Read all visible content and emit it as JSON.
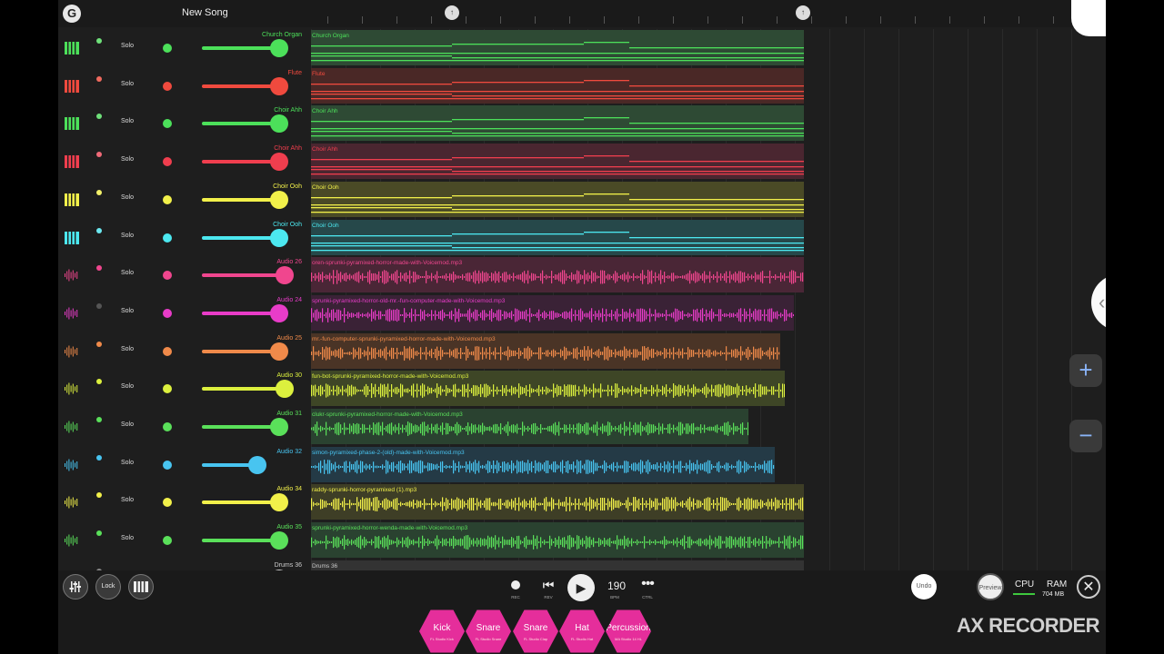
{
  "header": {
    "logo_glyph": "G",
    "song_title": "New Song",
    "marker_a": "↑",
    "marker_b": "↑"
  },
  "solo_label": "Solo",
  "tracks": [
    {
      "name": "Church Organ",
      "clip": "Church Organ",
      "type": "keys",
      "color": "#4ce05a",
      "bg": "#2e4a34",
      "volume": 0.85,
      "mute_color": "#6fe07a",
      "clip_end": 0.62
    },
    {
      "name": "Flute",
      "clip": "Flute",
      "type": "keys",
      "color": "#f04a3e",
      "bg": "#4a2826",
      "volume": 0.85,
      "mute_color": "#f06a5e",
      "clip_end": 0.62
    },
    {
      "name": "Choir Ahh",
      "clip": "Choir Ahh",
      "type": "keys",
      "color": "#4ce05a",
      "bg": "#2e4a34",
      "volume": 0.85,
      "mute_color": "#6fe07a",
      "clip_end": 0.62
    },
    {
      "name": "Choir Ahh",
      "clip": "Choir Ahh",
      "type": "keys",
      "color": "#f03e4e",
      "bg": "#4a2630",
      "volume": 0.85,
      "mute_color": "#f06a78",
      "clip_end": 0.62
    },
    {
      "name": "Choir Ooh",
      "clip": "Choir Ooh",
      "type": "keys",
      "color": "#f2f04a",
      "bg": "#4a4a26",
      "volume": 0.85,
      "mute_color": "#f2f06a",
      "clip_end": 0.62
    },
    {
      "name": "Choir Ooh",
      "clip": "Choir Ooh",
      "type": "keys",
      "color": "#4ce8f0",
      "bg": "#26484a",
      "volume": 0.85,
      "mute_color": "#6ce8f0",
      "clip_end": 0.62
    },
    {
      "name": "Audio 26",
      "clip": "oren-sprunki-pyramixed-horror-made-with-Voicemod.mp3",
      "type": "audio",
      "color": "#f0468e",
      "bg": "#4a2636",
      "volume": 0.92,
      "mute_color": "#f0468e",
      "clip_end": 0.62
    },
    {
      "name": "Audio 24",
      "clip": "sprunki-pyramixed-horror-old-mr.-fun-computer-made-with-Voicemod.mp3",
      "type": "audio",
      "color": "#e83cc8",
      "bg": "#3a2236",
      "volume": 0.85,
      "mute_color": "#555555",
      "clip_end": 0.608
    },
    {
      "name": "Audio 25",
      "clip": "mr.-fun-computer-sprunki-pyramixed-horror-made-with-Voicemod.mp3",
      "type": "audio",
      "color": "#f08a4a",
      "bg": "#4a3426",
      "volume": 0.85,
      "mute_color": "#f08a4a",
      "clip_end": 0.59
    },
    {
      "name": "Audio 30",
      "clip": "fun-bot-sprunki-pyramixed-horror-made-with-Voicemod.mp3",
      "type": "audio",
      "color": "#dcf03e",
      "bg": "#3e4626",
      "volume": 0.92,
      "mute_color": "#dcf03e",
      "clip_end": 0.596
    },
    {
      "name": "Audio 31",
      "clip": "clukr-sprunki-pyramixed-horror-made-with-Voicemod.mp3",
      "type": "audio",
      "color": "#5ae05a",
      "bg": "#2a4230",
      "volume": 0.85,
      "mute_color": "#5ae05a",
      "clip_end": 0.55
    },
    {
      "name": "Audio 32",
      "clip": "simon-pyramixed-phase-2-(old)-made-with-Voicemod.mp3",
      "type": "audio",
      "color": "#48c4f0",
      "bg": "#243a46",
      "volume": 0.6,
      "mute_color": "#48c4f0",
      "clip_end": 0.584
    },
    {
      "name": "Audio 34",
      "clip": "raddy-sprunki-horror-pyramixed (1).mp3",
      "type": "audio",
      "color": "#f2f04a",
      "bg": "#3e3e26",
      "volume": 0.85,
      "mute_color": "#f2f04a",
      "clip_end": 0.62
    },
    {
      "name": "Audio 35",
      "clip": "sprunki-pyramixed-horror-wenda-made-with-Voicemod.mp3",
      "type": "audio",
      "color": "#5ae05a",
      "bg": "#2a4230",
      "volume": 0.85,
      "mute_color": "#5ae05a",
      "clip_end": 0.62
    },
    {
      "name": "Drums 36",
      "clip": "Drums 36",
      "type": "drums",
      "color": "#cccccc",
      "bg": "#333333",
      "volume": 0.85,
      "mute_color": "#888888",
      "clip_end": 0.62
    }
  ],
  "side": {
    "chevron": "‹",
    "zoom_in": "+",
    "zoom_out": "−"
  },
  "bottom": {
    "mixer_icon": "mixer-icon",
    "lock_label": "Lock",
    "keyboard_icon": "piano-icon",
    "rec_label": "REC",
    "rev_label": "REV",
    "bpm_value": "190",
    "bpm_label": "BPM",
    "ctrl_label": "CTRL",
    "undo_label": "Undo",
    "preview_label": "Preview",
    "cpu_label": "CPU",
    "ram_label": "RAM",
    "ram_value": "704 MB",
    "close_glyph": "✕"
  },
  "pads": [
    {
      "name": "Kick",
      "sub": "FL Studio Kick"
    },
    {
      "name": "Snare",
      "sub": "FL Studio Snare"
    },
    {
      "name": "Snare",
      "sub": "FL Studio Clap"
    },
    {
      "name": "Hat",
      "sub": "FL Studio Hat"
    },
    {
      "name": "Percussion",
      "sub": "MA Studio 14 HL"
    }
  ],
  "watermark": "AX RECORDER"
}
